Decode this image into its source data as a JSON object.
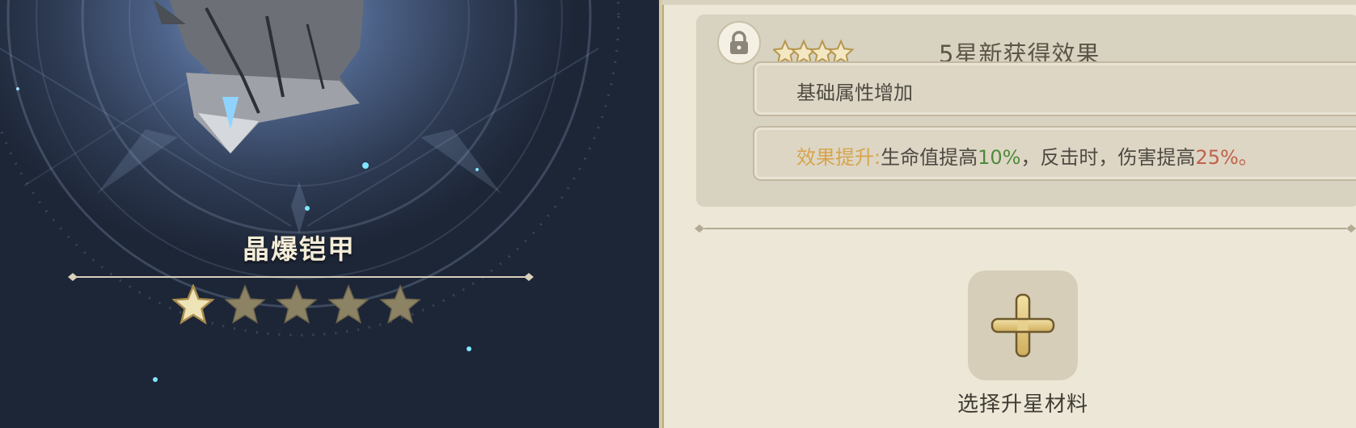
{
  "item": {
    "name": "晶爆铠甲",
    "rarity_filled": 1,
    "rarity_max": 5
  },
  "effect_card": {
    "stars": 4,
    "title": "5星新获得效果",
    "row1_text": "基础属性增加",
    "row2": {
      "prefix": "效果提升:",
      "part1": "生命值提高",
      "value1": "10%",
      "part2": "，反击时，伤害提高",
      "value2": "25%",
      "suffix": "。"
    }
  },
  "add_material": {
    "label": "选择升星材料"
  },
  "icons": {
    "lock": "lock-icon",
    "plus": "plus-icon",
    "star": "star-icon"
  },
  "colors": {
    "accent_gold": "#d8a44a",
    "value_green": "#4f8a3a",
    "value_red": "#c0614a",
    "panel_bg": "#ece7d6"
  }
}
